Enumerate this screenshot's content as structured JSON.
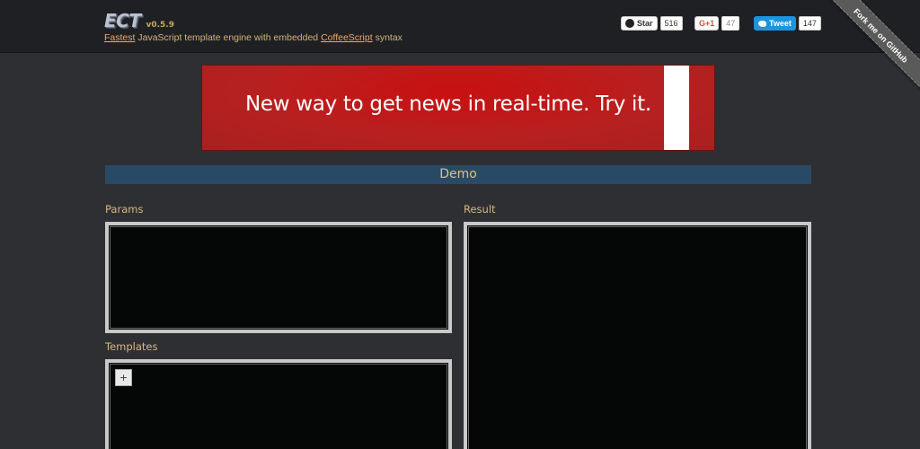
{
  "header": {
    "logo": "ECT",
    "version": "v0.5.9",
    "tagline": {
      "link1": "Fastest",
      "middle": " JavaScript template engine with embedded ",
      "link2": "CoffeeScript",
      "end": " syntax"
    }
  },
  "social": {
    "github": {
      "label": "Star",
      "count": "516"
    },
    "gplus": {
      "label": "G+1",
      "count": "47"
    },
    "twitter": {
      "label": "Tweet",
      "count": "147"
    }
  },
  "ribbon": {
    "label": "Fork me on GitHub"
  },
  "banner": {
    "text": "New way to get news in real-time. Try it."
  },
  "demo": {
    "title": "Demo"
  },
  "panels": {
    "params_label": "Params",
    "templates_label": "Templates",
    "result_label": "Result",
    "add_label": "+"
  },
  "colors": {
    "background": "#2e2f33",
    "header": "#1f2023",
    "banner": "#c91010",
    "demo_bar": "#284a66",
    "accent_text": "#e0c080",
    "link": "#f0a868"
  }
}
